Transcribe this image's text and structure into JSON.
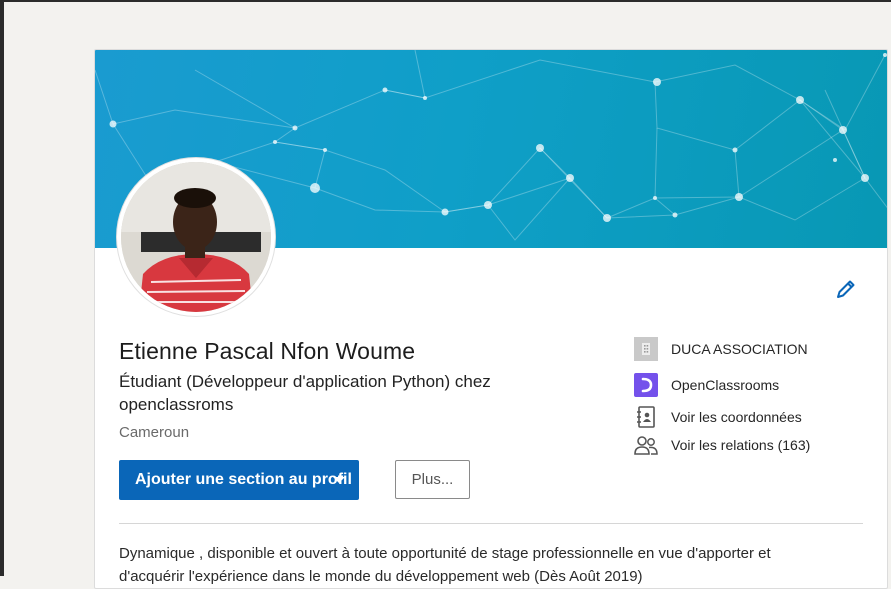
{
  "profile": {
    "name": "Etienne Pascal Nfon Woume",
    "headline": "Étudiant (Développeur d'application Python) chez openclassroms",
    "location": "Cameroun",
    "about": "Dynamique , disponible et ouvert à toute opportunité de stage professionnelle en vue d'apporter et d'acquérir l'expérience dans le monde du développement web (Dès Août 2019)"
  },
  "actions": {
    "add_section_label": "Ajouter une section au profil",
    "more_label": "Plus..."
  },
  "side": {
    "items": [
      {
        "label": "DUCA ASSOCIATION",
        "icon": "company-logo-icon"
      },
      {
        "label": "OpenClassrooms",
        "icon": "openclassrooms-logo-icon"
      },
      {
        "label": "Voir les coordonnées",
        "icon": "contact-card-icon"
      },
      {
        "label": "Voir les relations (163)",
        "icon": "connections-icon"
      }
    ]
  },
  "colors": {
    "primary": "#0a66b8",
    "banner": "#0f9fc8",
    "openclassrooms": "#7451eb"
  }
}
